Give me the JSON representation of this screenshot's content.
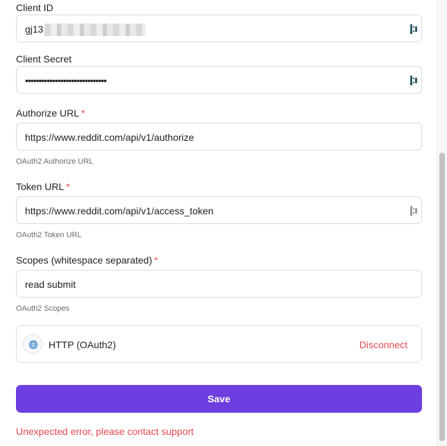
{
  "client_id": {
    "label": "Client ID",
    "value_visible_prefix": "gj13"
  },
  "client_secret": {
    "label": "Client Secret",
    "value_masked": "••••••••••••••••••••••••••••••"
  },
  "authorize_url": {
    "label": "Authorize URL",
    "required_mark": "*",
    "value": "https://www.reddit.com/api/v1/authorize",
    "help": "OAuth2 Authorize URL"
  },
  "token_url": {
    "label": "Token URL",
    "required_mark": "*",
    "value": "https://www.reddit.com/api/v1/access_token",
    "help": "OAuth2 Token URL"
  },
  "scopes": {
    "label": "Scopes (whitespace separated)",
    "required_mark": "*",
    "value": "read submit",
    "help": "OAuth2 Scopes"
  },
  "provider": {
    "name": "HTTP (OAuth2)",
    "icon": "globe-icon",
    "disconnect_label": "Disconnect"
  },
  "save_label": "Save",
  "error_message": "Unexpected error, please contact support",
  "colors": {
    "accent": "#6e3fe0",
    "danger": "#e5484d",
    "border": "#d9d9d9",
    "help_text": "#6b6b6b",
    "password_icon_teal": "#2f5d6b",
    "password_icon_gray": "#9a9a9a"
  }
}
